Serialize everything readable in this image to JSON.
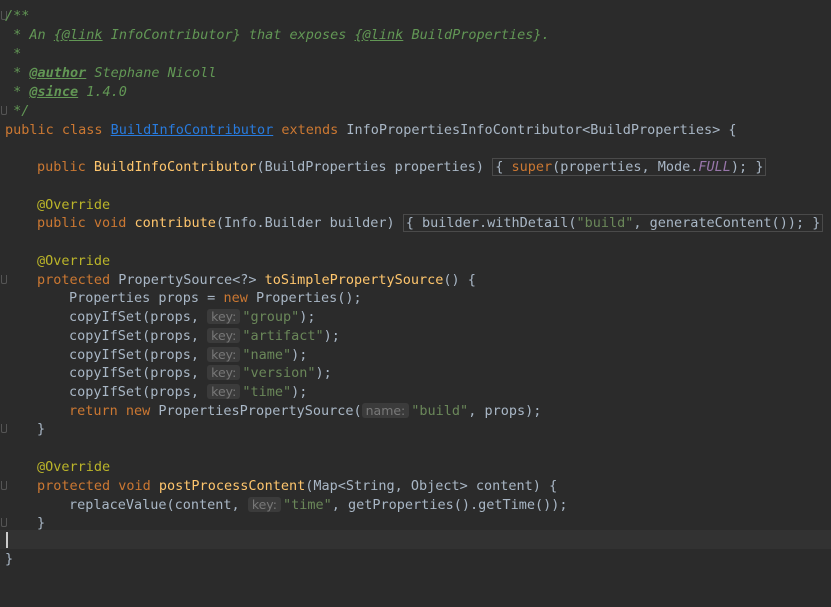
{
  "lines": {
    "l1": "/**",
    "l2_a": " * An ",
    "l2_link1": "{@link",
    "l2_b": " InfoContributor} that exposes ",
    "l2_link2": "{@link",
    "l2_c": " BuildProperties}.",
    "l3": " *",
    "l4_star": " * ",
    "l4_tag": "@author",
    "l4_text": " Stephane Nicoll",
    "l5_star": " * ",
    "l5_tag": "@since",
    "l5_text": " 1.4.0",
    "l6": " */",
    "l7_kw1": "public class ",
    "l7_cls": "BuildInfoContributor",
    "l7_kw2": " extends ",
    "l7_rest": "InfoPropertiesInfoContributor<BuildProperties> {",
    "l9_kw": "public ",
    "l9_fn": "BuildInfoContributor",
    "l9_args": "(BuildProperties properties)",
    "l9_fold_open": "{ ",
    "l9_super": "super",
    "l9_mid": "(properties, Mode.",
    "l9_field": "FULL",
    "l9_end": "); ",
    "l9_fold_close": "}",
    "l11_ann": "@Override",
    "l12_kw": "public void ",
    "l12_fn": "contribute",
    "l12_args": "(Info.Builder builder)",
    "l12_fold_open": "{ ",
    "l12_body1": "builder.withDetail(",
    "l12_str": "\"build\"",
    "l12_body2": ", generateContent()); ",
    "l12_fold_close": "}",
    "l14_ann": "@Override",
    "l15_kw": "protected ",
    "l15_type": "PropertySource<?> ",
    "l15_fn": "toSimplePropertySource",
    "l15_rest": "() {",
    "l16_a": "Properties props = ",
    "l16_kw": "new ",
    "l16_b": "Properties();",
    "copy_call": "copyIfSet(props, ",
    "hint_key": "key:",
    "hint_name": "name:",
    "copy_end": ");",
    "s_group": "\"group\"",
    "s_artifact": "\"artifact\"",
    "s_name": "\"name\"",
    "s_version": "\"version\"",
    "s_time": "\"time\"",
    "l22_kw": "return new ",
    "l22_a": "PropertiesPropertySource(",
    "l22_str": "\"build\"",
    "l22_b": ", props);",
    "l23": "}",
    "l25_ann": "@Override",
    "l26_kw": "protected void ",
    "l26_fn": "postProcessContent",
    "l26_rest": "(Map<String, Object> content) {",
    "l27_a": "replaceValue(content, ",
    "l27_str": "\"time\"",
    "l27_b": ", getProperties().getTime());",
    "l28": "}",
    "l30": "}"
  },
  "colors": {
    "background": "#2b2b2b",
    "keyword": "#cc7832",
    "javadoc": "#629755",
    "annotation": "#bbb529",
    "method": "#ffc66d",
    "string": "#6a8759",
    "field": "#9876aa",
    "link": "#287bde"
  }
}
